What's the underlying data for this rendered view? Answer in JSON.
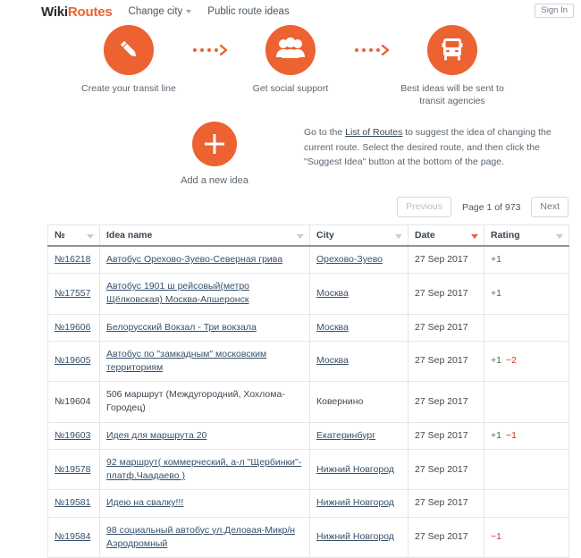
{
  "header": {
    "logo_primary": "Wiki",
    "logo_secondary": "Routes",
    "change_city": "Change city",
    "public_route_ideas": "Public route ideas",
    "sign_in": "Sign In",
    "accent_color": "#ec6231"
  },
  "steps": [
    {
      "icon": "pencil-icon",
      "label": "Create your transit line"
    },
    {
      "icon": "people-icon",
      "label": "Get social support"
    },
    {
      "icon": "bus-icon",
      "label": "Best ideas will be sent to transit agencies"
    }
  ],
  "add_idea": {
    "icon": "plus-icon",
    "label": "Add a new idea"
  },
  "description": {
    "before_link": "Go to the ",
    "link_text": "List of Routes",
    "after_link": " to suggest the idea of changing the current route. Select the desired route, and then click the \"Suggest Idea\" button at the bottom of the page."
  },
  "pagination": {
    "previous": "Previous",
    "page_info": "Page 1 of 973",
    "next": "Next"
  },
  "table": {
    "columns": [
      {
        "label": "№",
        "sorted": false
      },
      {
        "label": "Idea name",
        "sorted": false
      },
      {
        "label": "City",
        "sorted": false
      },
      {
        "label": "Date",
        "sorted": true
      },
      {
        "label": "Rating",
        "sorted": false
      }
    ],
    "rows": [
      {
        "number": "№16218",
        "number_link": true,
        "idea": "Автобус Орехово-Зуево-Северная грива",
        "idea_link": true,
        "city": "Орехово-Зуево",
        "city_link": true,
        "date": "27 Sep 2017",
        "rating_pos": "+1",
        "rating_neg": ""
      },
      {
        "number": "№17557",
        "number_link": true,
        "idea": "Автобус 1901 ш рейсовый(метро Щёлковская) Москва-Апшеронск",
        "idea_link": true,
        "city": "Москва",
        "city_link": true,
        "date": "27 Sep 2017",
        "rating_pos": "+1",
        "rating_neg": ""
      },
      {
        "number": "№19606",
        "number_link": true,
        "idea": "Белорусский Вокзал - Три вокзала",
        "idea_link": true,
        "city": "Москва",
        "city_link": true,
        "date": "27 Sep 2017",
        "rating_pos": "",
        "rating_neg": ""
      },
      {
        "number": "№19605",
        "number_link": true,
        "idea": "Автобус по \"замкадным\" московским территориям",
        "idea_link": true,
        "city": "Москва",
        "city_link": true,
        "date": "27 Sep 2017",
        "rating_pos": "+1",
        "rating_neg": "−2"
      },
      {
        "number": "№19604",
        "number_link": false,
        "idea": "506 маршрут (Междугородний, Хохлома-Городец)",
        "idea_link": false,
        "city": "Ковернино",
        "city_link": false,
        "date": "27 Sep 2017",
        "rating_pos": "",
        "rating_neg": ""
      },
      {
        "number": "№19603",
        "number_link": true,
        "idea": "Идея для маршрута 20",
        "idea_link": true,
        "city": "Екатеринбург",
        "city_link": true,
        "date": "27 Sep 2017",
        "rating_pos": "+1",
        "rating_neg": "−1"
      },
      {
        "number": "№19578",
        "number_link": true,
        "idea": "92 маршрут( коммерческий, а-л \"Щербинки\"-платф.Чаадаево )",
        "idea_link": true,
        "city": "Нижний Новгород",
        "city_link": true,
        "date": "27 Sep 2017",
        "rating_pos": "",
        "rating_neg": ""
      },
      {
        "number": "№19581",
        "number_link": true,
        "idea": "Идею на свалку!!!",
        "idea_link": true,
        "city": "Нижний Новгород",
        "city_link": true,
        "date": "27 Sep 2017",
        "rating_pos": "",
        "rating_neg": ""
      },
      {
        "number": "№19584",
        "number_link": true,
        "idea": "98 социальный автобус ул.Деловая-Микр/н Аэродромный",
        "idea_link": true,
        "city": "Нижний Новгород",
        "city_link": true,
        "date": "27 Sep 2017",
        "rating_pos": "",
        "rating_neg": "−1"
      }
    ]
  },
  "colors": {
    "accent": "#ec6231",
    "positive": "#2f7d32",
    "negative": "#d9342b",
    "link": "#37506b"
  }
}
